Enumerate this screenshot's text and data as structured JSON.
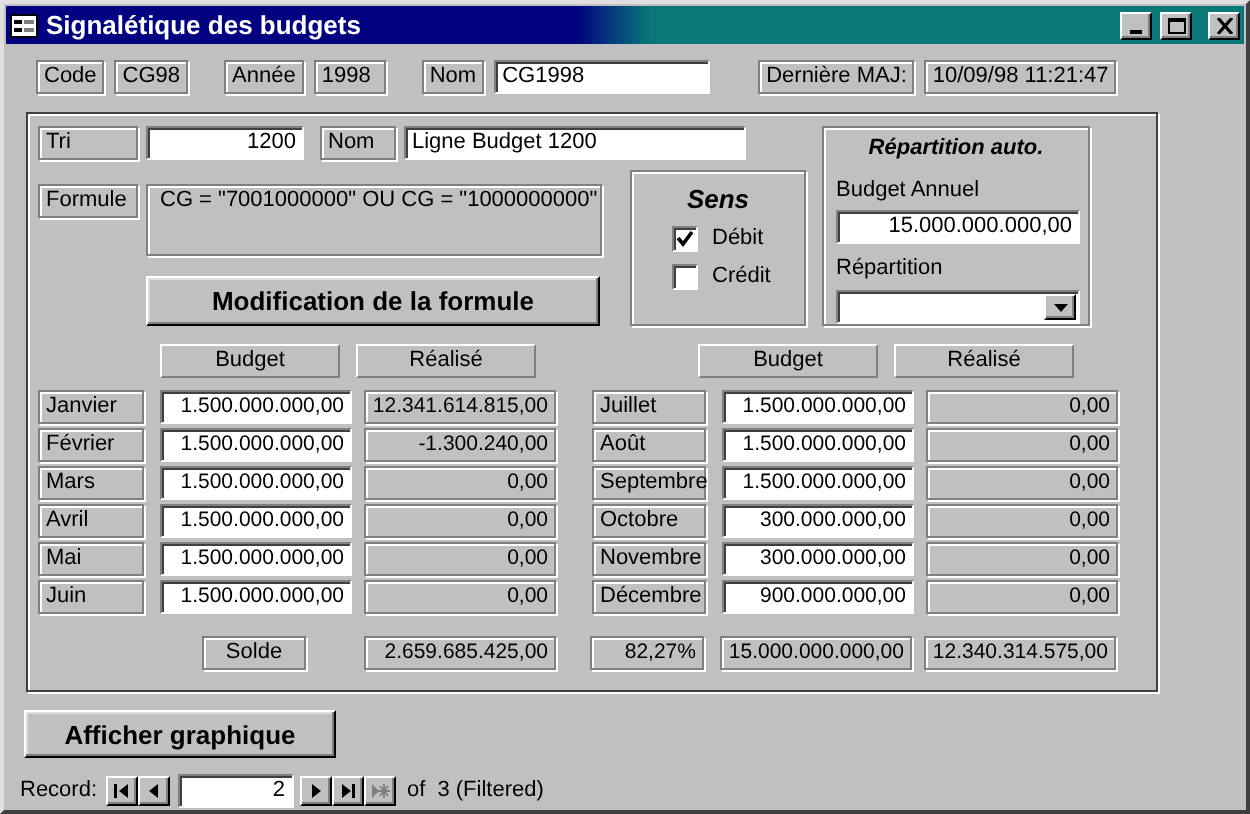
{
  "window": {
    "title": "Signalétique des budgets"
  },
  "header": [
    {
      "label": "Code",
      "value": "CG98",
      "kind": "readonly"
    },
    {
      "label": "Année",
      "value": "1998",
      "kind": "readonly"
    },
    {
      "label": "Nom",
      "value": "CG1998",
      "kind": "input"
    },
    {
      "label": "Dernière MAJ:",
      "value": "10/09/98 11:21:47",
      "kind": "readonly"
    }
  ],
  "tri": {
    "label": "Tri",
    "value": "1200"
  },
  "nom": {
    "label": "Nom",
    "value": "Ligne Budget 1200"
  },
  "formule": {
    "label": "Formule",
    "value": "CG = \"7001000000\" OU CG = \"1000000000\""
  },
  "modify_button": "Modification de la formule",
  "sens": {
    "title": "Sens",
    "options": [
      {
        "label": "Débit",
        "checked": true
      },
      {
        "label": "Crédit",
        "checked": false
      }
    ]
  },
  "repartition": {
    "title": "Répartition auto.",
    "budget_label": "Budget Annuel",
    "budget_value": "15.000.000.000,00",
    "repartition_label": "Répartition"
  },
  "left_columns": [
    "Budget",
    "Réalisé"
  ],
  "right_columns": [
    "Budget",
    "Réalisé"
  ],
  "left_months": [
    {
      "month": "Janvier",
      "budget": "1.500.000.000,00",
      "realise": "12.341.614.815,00"
    },
    {
      "month": "Février",
      "budget": "1.500.000.000,00",
      "realise": "-1.300.240,00"
    },
    {
      "month": "Mars",
      "budget": "1.500.000.000,00",
      "realise": "0,00"
    },
    {
      "month": "Avril",
      "budget": "1.500.000.000,00",
      "realise": "0,00"
    },
    {
      "month": "Mai",
      "budget": "1.500.000.000,00",
      "realise": "0,00"
    },
    {
      "month": "Juin",
      "budget": "1.500.000.000,00",
      "realise": "0,00"
    }
  ],
  "right_months": [
    {
      "month": "Juillet",
      "budget": "1.500.000.000,00",
      "realise": "0,00"
    },
    {
      "month": "Août",
      "budget": "1.500.000.000,00",
      "realise": "0,00"
    },
    {
      "month": "Septembre",
      "budget": "1.500.000.000,00",
      "realise": "0,00"
    },
    {
      "month": "Octobre",
      "budget": "300.000.000,00",
      "realise": "0,00"
    },
    {
      "month": "Novembre",
      "budget": "300.000.000,00",
      "realise": "0,00"
    },
    {
      "month": "Décembre",
      "budget": "900.000.000,00",
      "realise": "0,00"
    }
  ],
  "totals": {
    "label": "Solde",
    "solde": "2.659.685.425,00",
    "percent": "82,27%",
    "budget": "15.000.000.000,00",
    "realise": "12.340.314.575,00"
  },
  "chart_button": "Afficher graphique",
  "record_nav": {
    "label": "Record:",
    "current": "2",
    "of": "of",
    "total": "3 (Filtered)",
    "buttons": [
      {
        "kind": "first",
        "disabled": false
      },
      {
        "kind": "prev",
        "disabled": false
      },
      {
        "kind": "next",
        "disabled": false
      },
      {
        "kind": "last",
        "disabled": false
      },
      {
        "kind": "new",
        "disabled": true
      }
    ]
  }
}
